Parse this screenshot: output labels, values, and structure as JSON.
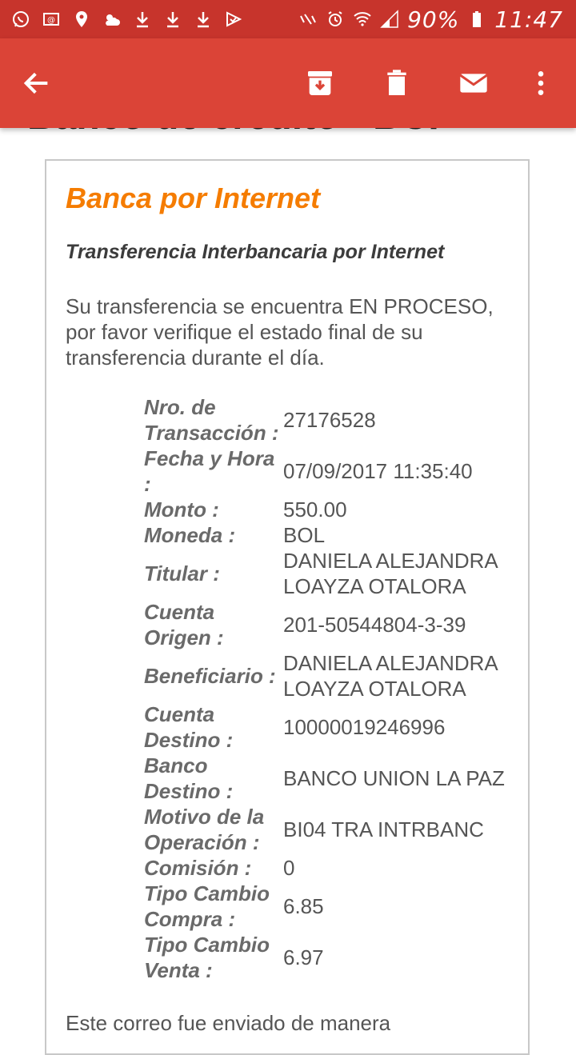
{
  "status_bar": {
    "battery_percent": "90%",
    "time": "11:47"
  },
  "email": {
    "subject_peek": "Banco de crédito - BCP",
    "brand_title": "Banca por Internet",
    "subtitle": "Transferencia Interbancaria por Internet",
    "intro": "Su transferencia se encuentra EN PROCESO, por favor verifique el estado final de su transferencia durante el día.",
    "details": [
      {
        "label": "Nro. de Transacción :",
        "value": "27176528"
      },
      {
        "label": "Fecha y Hora :",
        "value": "07/09/2017 11:35:40"
      },
      {
        "label": "Monto :",
        "value": "550.00"
      },
      {
        "label": "Moneda :",
        "value": "BOL"
      },
      {
        "label": "Titular :",
        "value": "DANIELA ALEJANDRA LOAYZA OTALORA"
      },
      {
        "label": "Cuenta Origen :",
        "value": "201-50544804-3-39"
      },
      {
        "label": "Beneficiario :",
        "value": "DANIELA ALEJANDRA LOAYZA OTALORA"
      },
      {
        "label": "Cuenta Destino :",
        "value": "10000019246996"
      },
      {
        "label": "Banco Destino :",
        "value": "BANCO UNION LA PAZ"
      },
      {
        "label": "Motivo de la Operación :",
        "value": "BI04 TRA INTRBANC"
      },
      {
        "label": "Comisión :",
        "value": "0"
      },
      {
        "label": "Tipo Cambio Compra :",
        "value": "6.85"
      },
      {
        "label": "Tipo Cambio Venta :",
        "value": "6.97"
      }
    ],
    "footer_partial": "Este correo fue enviado de manera"
  }
}
